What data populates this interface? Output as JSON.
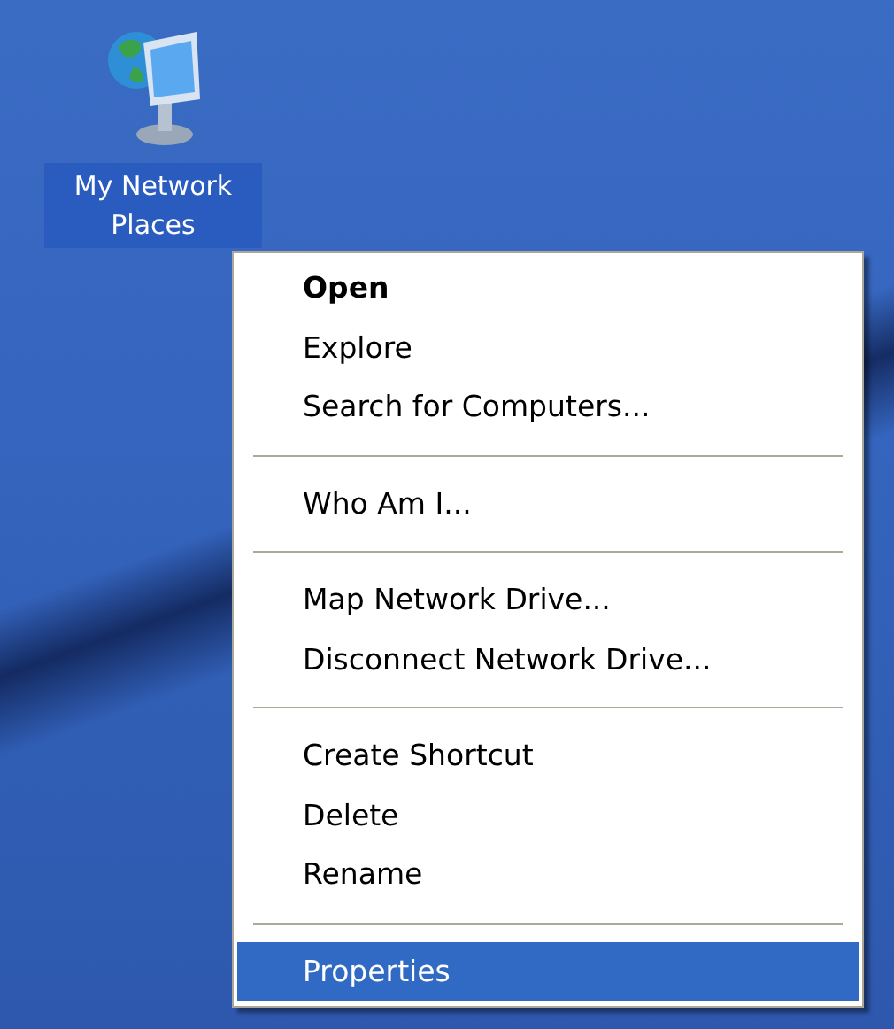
{
  "desktop_icon": {
    "label": "My Network Places",
    "selected": true
  },
  "context_menu": {
    "items": [
      {
        "kind": "item",
        "label": "Open",
        "default": true,
        "selected": false
      },
      {
        "kind": "item",
        "label": "Explore",
        "default": false,
        "selected": false
      },
      {
        "kind": "item",
        "label": "Search for Computers...",
        "default": false,
        "selected": false
      },
      {
        "kind": "separator"
      },
      {
        "kind": "item",
        "label": "Who Am I...",
        "default": false,
        "selected": false
      },
      {
        "kind": "separator"
      },
      {
        "kind": "item",
        "label": "Map Network Drive...",
        "default": false,
        "selected": false
      },
      {
        "kind": "item",
        "label": "Disconnect Network Drive...",
        "default": false,
        "selected": false
      },
      {
        "kind": "separator"
      },
      {
        "kind": "item",
        "label": "Create Shortcut",
        "default": false,
        "selected": false
      },
      {
        "kind": "item",
        "label": "Delete",
        "default": false,
        "selected": false
      },
      {
        "kind": "item",
        "label": "Rename",
        "default": false,
        "selected": false
      },
      {
        "kind": "separator"
      },
      {
        "kind": "item",
        "label": "Properties",
        "default": false,
        "selected": true
      }
    ]
  }
}
